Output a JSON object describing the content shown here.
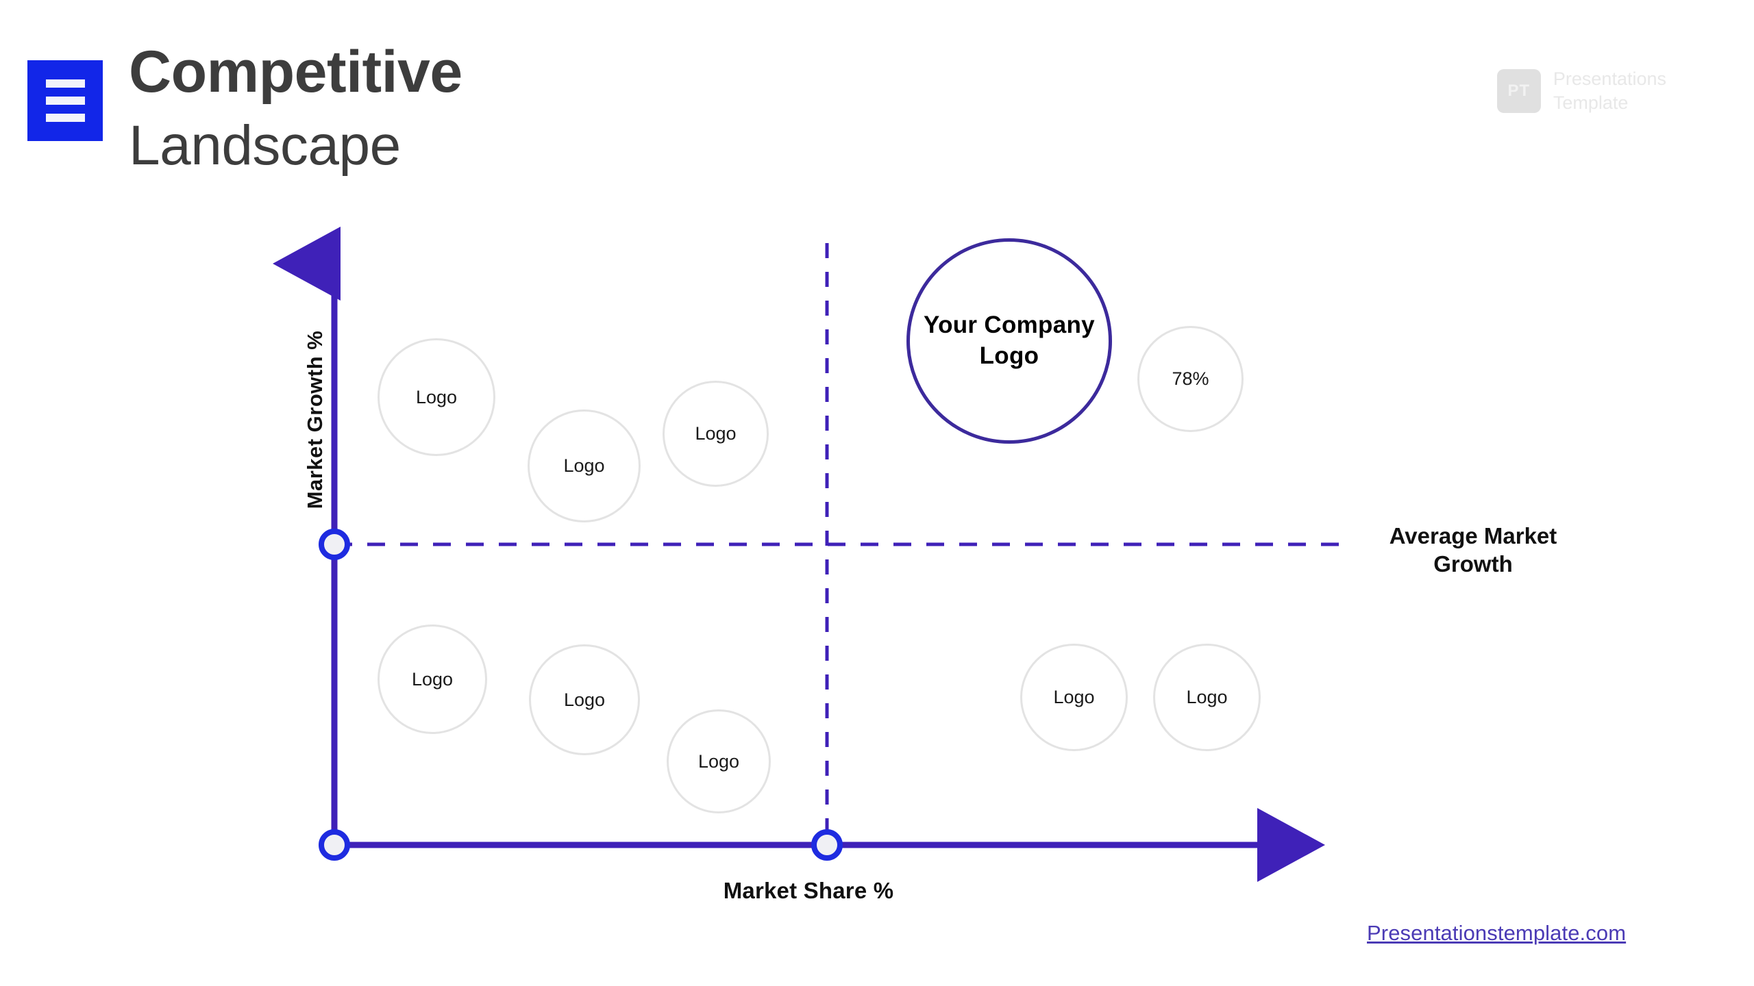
{
  "header": {
    "menu_icon": "hamburger-icon",
    "title_line_1": "Competitive",
    "title_line_2": "Landscape"
  },
  "brand": {
    "mark": "PT",
    "name_line_1": "Presentations",
    "name_line_2": "Template"
  },
  "colors": {
    "menu_blue": "#1226E8",
    "axis_purple": "#3F21B8",
    "marker_blue": "#1E2BE0",
    "highlight_border": "#3C2A9C",
    "bubble_border": "#E3E3E3",
    "title_gray": "#3D3D3D",
    "footer_purple": "#4B3BB5",
    "watermark_gray": "#E8E8E8"
  },
  "chart_data": {
    "type": "scatter",
    "title": "Competitive Landscape",
    "xlabel": "Market Share %",
    "ylabel": "Market Growth %",
    "grid": false,
    "legend": null,
    "annotations": [
      {
        "text": "Average Market Growth",
        "kind": "horizontal-divider-label"
      }
    ],
    "quadrant_lines": {
      "horizontal_label": "Average Market Growth",
      "horizontal_value_note": "average market growth threshold",
      "vertical_value_note": "average market share threshold"
    },
    "points": [
      {
        "label": "Logo",
        "quadrant": "upper-left",
        "x": 0.13,
        "y": 0.78,
        "size": "medium",
        "highlight": false
      },
      {
        "label": "Logo",
        "quadrant": "upper-left",
        "x": 0.28,
        "y": 0.7,
        "size": "medium",
        "highlight": false
      },
      {
        "label": "Logo",
        "quadrant": "upper-left",
        "x": 0.41,
        "y": 0.73,
        "size": "medium",
        "highlight": false
      },
      {
        "label": "Your Company Logo",
        "quadrant": "upper-right",
        "x": 0.69,
        "y": 0.82,
        "size": "large",
        "highlight": true
      },
      {
        "label": "78%",
        "quadrant": "upper-right",
        "x": 0.85,
        "y": 0.76,
        "size": "medium",
        "highlight": false
      },
      {
        "label": "Logo",
        "quadrant": "lower-left",
        "x": 0.12,
        "y": 0.28,
        "size": "medium",
        "highlight": false
      },
      {
        "label": "Logo",
        "quadrant": "lower-left",
        "x": 0.27,
        "y": 0.26,
        "size": "medium",
        "highlight": false
      },
      {
        "label": "Logo",
        "quadrant": "lower-left",
        "x": 0.41,
        "y": 0.2,
        "size": "medium",
        "highlight": false
      },
      {
        "label": "Logo",
        "quadrant": "lower-right",
        "x": 0.77,
        "y": 0.25,
        "size": "medium",
        "highlight": false
      },
      {
        "label": "Logo",
        "quadrant": "lower-right",
        "x": 0.9,
        "y": 0.25,
        "size": "medium",
        "highlight": false
      }
    ]
  },
  "bubbles": {
    "c1": {
      "label": "Logo"
    },
    "c2": {
      "label": "Logo"
    },
    "c3": {
      "label": "Logo"
    },
    "c4": {
      "label": "Logo"
    },
    "c5": {
      "label": "Logo"
    },
    "c6": {
      "label": "Logo"
    },
    "c7": {
      "label": "Logo"
    },
    "c8": {
      "label": "Logo"
    },
    "pct": {
      "label": "78%"
    },
    "highlight": {
      "line_1": "Your Company",
      "line_2": "Logo"
    }
  },
  "axes": {
    "y_title": "Market Growth %",
    "x_title": "Market Share %",
    "avg_growth_label": "Average Market Growth"
  },
  "footer": {
    "link": "Presentationstemplate.com"
  }
}
